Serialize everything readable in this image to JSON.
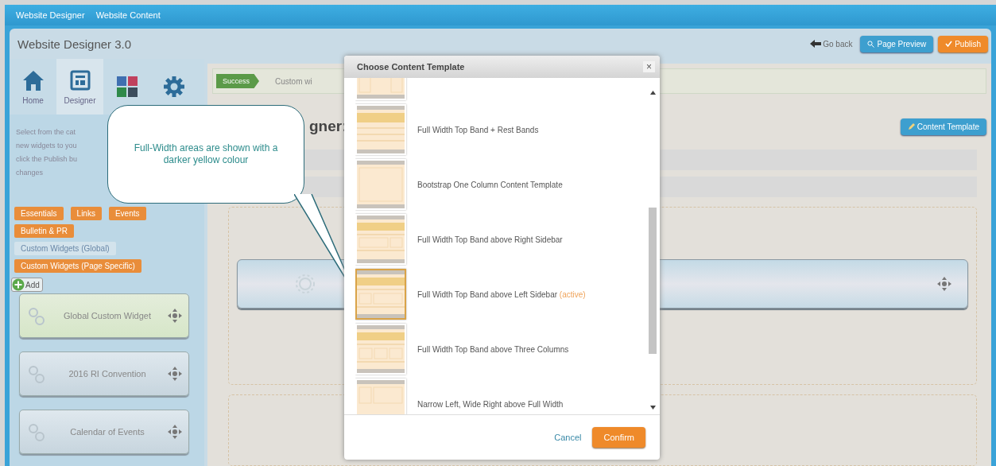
{
  "top_nav": [
    {
      "label": "Website Designer"
    },
    {
      "label": "Website Content"
    }
  ],
  "window": {
    "title": "Website Designer 3.0",
    "go_back": "Go back",
    "buttons": [
      {
        "label": "Page Preview",
        "kind": "preview"
      },
      {
        "label": "Publish",
        "kind": "publish"
      }
    ]
  },
  "sidebar": {
    "tabs": [
      {
        "label": "Home",
        "selected": false
      },
      {
        "label": "Designer",
        "selected": true
      },
      {
        "selected": false
      },
      {
        "selected": false
      }
    ],
    "help_lines": [
      "Select from the cat",
      "new widgets to you",
      "click the Publish bu",
      "changes"
    ],
    "categories": [
      {
        "label": "Essentials",
        "selected": false
      },
      {
        "label": "Links",
        "selected": false
      },
      {
        "label": "Events",
        "selected": false
      },
      {
        "label": "Bulletin & PR",
        "selected": false
      },
      {
        "label": "Custom Widgets (Global)",
        "selected": true
      },
      {
        "label": "Custom Widgets (Page Specific)",
        "selected": false
      }
    ],
    "add_button": "Add",
    "widgets": [
      {
        "label": "Global Custom Widget",
        "kind": "global"
      },
      {
        "label": "2016 RI Convention",
        "kind": "page"
      },
      {
        "label": "Calendar of Events",
        "kind": "page"
      }
    ]
  },
  "main": {
    "status_badge": "Success",
    "status_message": "Custom wi",
    "heading": "gner:",
    "content_template_button": "Content Template"
  },
  "callout": {
    "text": "Full-Width areas are shown with a darker yellow colour"
  },
  "dialog": {
    "title": "Choose Content Template",
    "close": "×",
    "templates": [
      {
        "selected": false
      },
      {
        "label": "Full Width Top Band + Rest Bands",
        "selected": false
      },
      {
        "label": "Bootstrap One Column Content Template",
        "selected": false
      },
      {
        "label": "Full Width Top Band above Right Sidebar",
        "selected": false
      },
      {
        "label": "Full Width Top Band above Left Sidebar",
        "note": "(active)",
        "selected": true
      },
      {
        "label": "Full Width Top Band above Three Columns",
        "selected": false
      },
      {
        "label": "Narrow Left, Wide Right above Full Width",
        "selected": false
      }
    ],
    "cancel": "Cancel",
    "confirm": "Confirm"
  }
}
